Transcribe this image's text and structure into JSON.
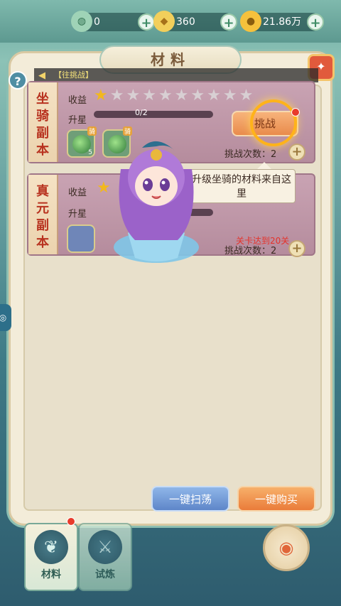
{
  "resources": [
    {
      "icon": "jade-icon",
      "glyph": "◍",
      "value": "0"
    },
    {
      "icon": "ingot-icon",
      "glyph": "◆",
      "value": "360"
    },
    {
      "icon": "coin-icon",
      "glyph": "●",
      "value": "21.86万"
    }
  ],
  "panel": {
    "title": "材料",
    "ticker": "【往挑战】"
  },
  "cards": [
    {
      "name": "坐骑副本",
      "reward_label": "收益",
      "stars_total": 10,
      "stars_filled": 1,
      "upgrade_label": "升星",
      "progress_text": "0/2",
      "progress_fraction": 0,
      "items": [
        {
          "tag": "骑",
          "count": "5"
        },
        {
          "tag": "骑",
          "count": ""
        }
      ],
      "challenge_label": "挑战",
      "count_label": "挑战次数：",
      "count_value": "2"
    },
    {
      "name": "真元副本",
      "reward_label": "收益",
      "upgrade_label": "升星",
      "requirement": "关卡达到20关",
      "count_label": "挑战次数：",
      "count_value": "2"
    }
  ],
  "tooltip": "升级坐骑的材料来自这里",
  "buttons": {
    "sweep": "一键扫荡",
    "buy": "一键购买"
  },
  "tabs": [
    {
      "label": "材料",
      "selected": true
    },
    {
      "label": "试炼",
      "selected": false
    }
  ],
  "colors": {
    "accent": "#ffb31a",
    "alert": "#e5322a"
  }
}
